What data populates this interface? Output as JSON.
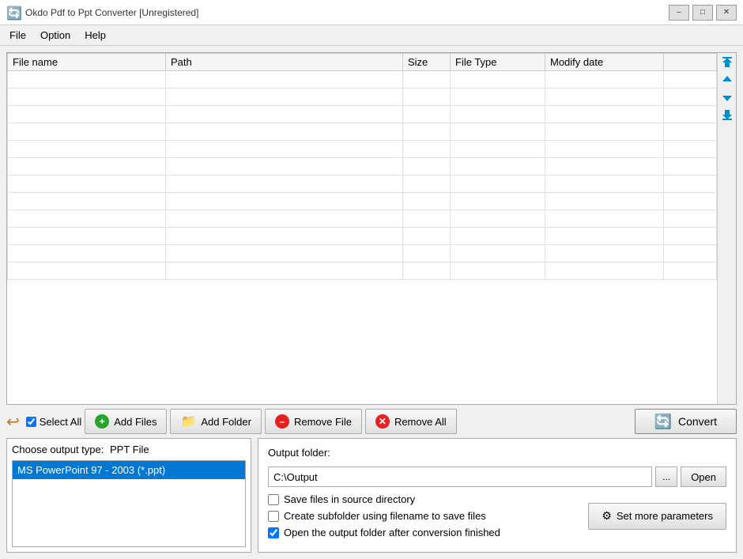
{
  "app": {
    "title": "Okdo Pdf to Ppt Converter [Unregistered]",
    "icon": "🔄"
  },
  "titlebar": {
    "minimize_label": "–",
    "maximize_label": "□",
    "close_label": "✕"
  },
  "menu": {
    "items": [
      {
        "id": "file",
        "label": "File"
      },
      {
        "id": "option",
        "label": "Option"
      },
      {
        "id": "help",
        "label": "Help"
      }
    ]
  },
  "file_table": {
    "columns": [
      {
        "id": "name",
        "label": "File name"
      },
      {
        "id": "path",
        "label": "Path"
      },
      {
        "id": "size",
        "label": "Size"
      },
      {
        "id": "type",
        "label": "File Type"
      },
      {
        "id": "date",
        "label": "Modify date"
      }
    ],
    "rows": []
  },
  "scroll_buttons": {
    "top": "⇈",
    "up": "↑",
    "down": "↓",
    "bottom": "⇊"
  },
  "toolbar": {
    "select_all_label": "Select All",
    "back_icon": "↩",
    "add_files_label": "Add Files",
    "add_folder_label": "Add Folder",
    "remove_file_label": "Remove File",
    "remove_all_label": "Remove All",
    "convert_label": "Convert"
  },
  "output_type": {
    "title": "Choose output type:",
    "current": "PPT File",
    "options": [
      {
        "id": "ppt97",
        "label": "MS PowerPoint 97 - 2003 (*.ppt)"
      }
    ]
  },
  "output_folder": {
    "label": "Output folder:",
    "path": "C:\\Output",
    "browse_label": "...",
    "open_label": "Open",
    "options": [
      {
        "id": "save_in_source",
        "label": "Save files in source directory",
        "checked": false
      },
      {
        "id": "create_subfolder",
        "label": "Create subfolder using filename to save files",
        "checked": false
      },
      {
        "id": "open_after",
        "label": "Open the output folder after conversion finished",
        "checked": true
      }
    ],
    "params_label": "Set more parameters"
  }
}
